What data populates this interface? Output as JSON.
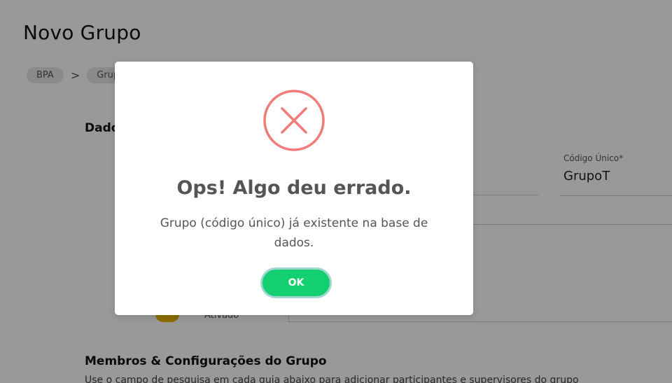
{
  "page": {
    "title": "Novo Grupo",
    "breadcrumb": [
      "BPA",
      "Grupo"
    ],
    "breadcrumb_separator": ">",
    "section_1_title": "Dados",
    "section_2_title": "Membros & Configurações do Grupo",
    "section_2_description": "Use o campo de pesquisa em cada guia abaixo para adicionar participantes e supervisores do grupo",
    "codigo_unico_label": "Código Único*",
    "codigo_unico_value": "GrupoT",
    "toggle_label": "Ativado",
    "toggle_color": "#e8b400"
  },
  "modal": {
    "icon": "error-x-circle-icon",
    "icon_color": "#f07b79",
    "title": "Ops! Algo deu errado.",
    "message": "Grupo (código único) já existente na base de dados.",
    "ok_label": "OK",
    "ok_color": "#13cf6f"
  }
}
